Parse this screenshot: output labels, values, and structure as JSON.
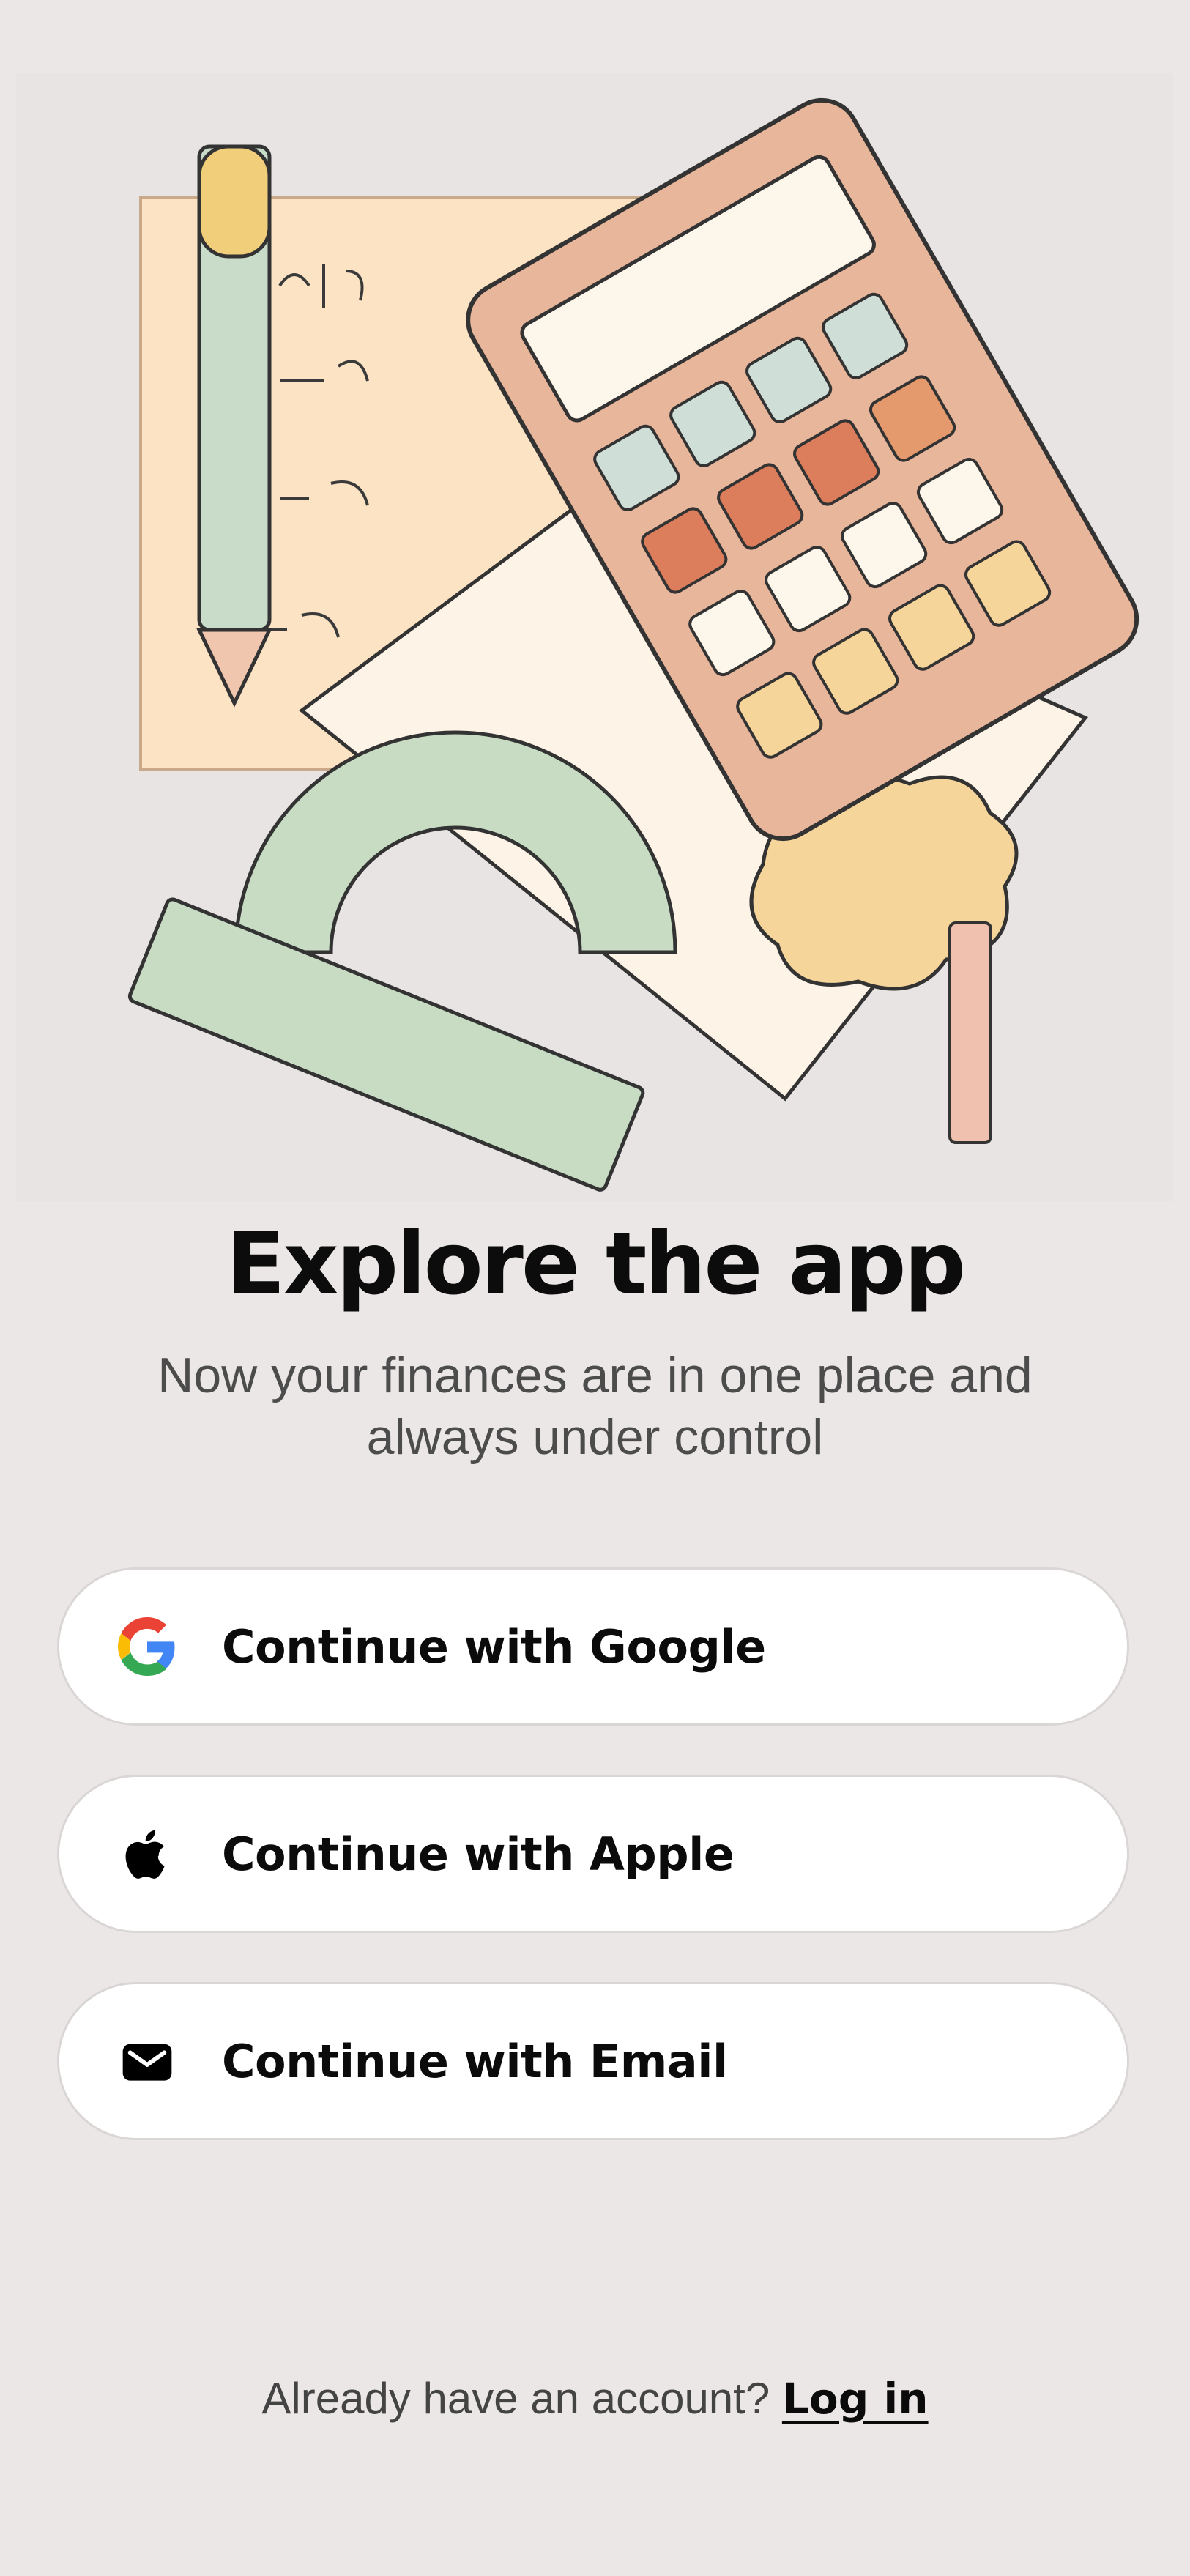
{
  "hero": {
    "illustration": "math-stationery-illustration"
  },
  "onboarding": {
    "title": "Explore the app",
    "subtitle": "Now your finances are in one place and always under control"
  },
  "auth": {
    "google_label": "Continue with Google",
    "apple_label": "Continue with Apple",
    "email_label": "Continue with Email"
  },
  "footer": {
    "prompt": "Already have an account?",
    "login_label": "Log in"
  },
  "colors": {
    "background": "#ebe7e6",
    "button_bg": "#ffffff",
    "text_primary": "#0b0b0b",
    "text_secondary": "#4c4c4c"
  }
}
